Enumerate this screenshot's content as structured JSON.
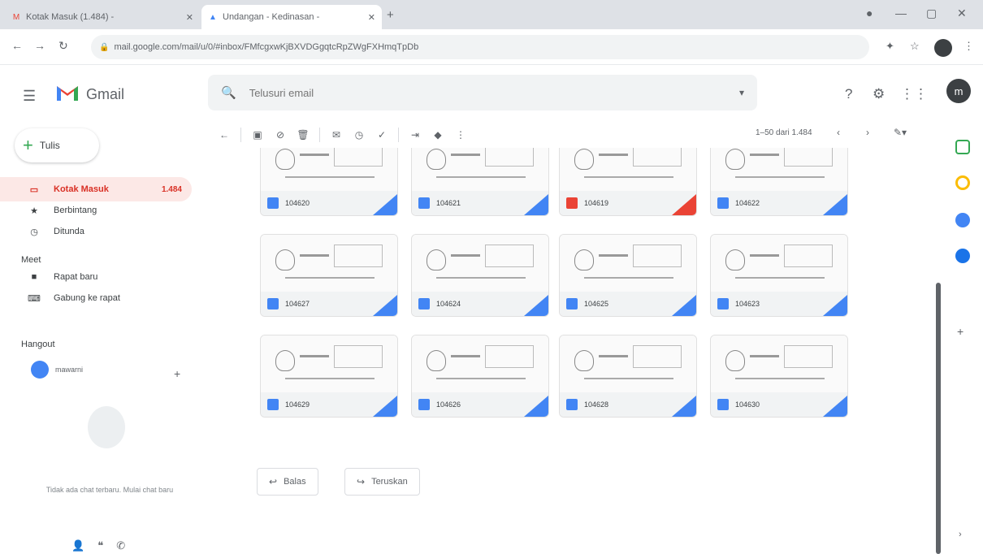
{
  "browser": {
    "tabs": [
      {
        "title": "Kotak Masuk (1.484) - ",
        "active": false
      },
      {
        "title": "Undangan - Kedinasan - ",
        "active": true
      }
    ],
    "url": "mail.google.com/mail/u/0/#inbox/FMfcgxwKjBXVDGgqtcRpZWgFXHmqTpDb"
  },
  "gmail": {
    "app_name": "Gmail",
    "search_placeholder": "Telusuri email",
    "avatar_initial": "m"
  },
  "sidebar": {
    "compose_label": "Tulis",
    "items": [
      {
        "label": "Kotak Masuk",
        "count": "1.484",
        "icon": "inbox-icon",
        "active": true
      },
      {
        "label": "Berbintang",
        "count": "",
        "icon": "star-icon",
        "active": false
      },
      {
        "label": "Ditunda",
        "count": "",
        "icon": "clock-icon",
        "active": false
      }
    ],
    "meet_heading": "Meet",
    "meet_items": [
      {
        "label": "Rapat baru",
        "icon": "video-icon"
      },
      {
        "label": "Gabung ke rapat",
        "icon": "keyboard-icon"
      }
    ],
    "hangouts_heading": "Hangout",
    "hangouts_user_name": "mawarni",
    "hangouts_user_status": "",
    "hangouts_message": "Tidak ada chat terbaru. Mulai chat baru",
    "hangouts_link": "",
    "bottom_icons": [
      "person-icon",
      "hangouts-icon",
      "phone-icon"
    ]
  },
  "toolbar": {
    "page_info": "1–50 dari 1.484",
    "icons": [
      "back-arrow-icon",
      "archive-icon",
      "report-spam-icon",
      "delete-icon",
      "mark-unread-icon",
      "snooze-icon",
      "add-task-icon",
      "move-to-icon",
      "label-icon",
      "more-icon"
    ]
  },
  "attachments": [
    {
      "name": "104620",
      "type": "doc",
      "row": 0,
      "col": 0
    },
    {
      "name": "104621",
      "type": "doc",
      "row": 0,
      "col": 1
    },
    {
      "name": "104619",
      "type": "pdf",
      "row": 0,
      "col": 2
    },
    {
      "name": "104622",
      "type": "doc",
      "row": 0,
      "col": 3
    },
    {
      "name": "104627",
      "type": "doc",
      "row": 1,
      "col": 0
    },
    {
      "name": "104624",
      "type": "doc",
      "row": 1,
      "col": 1
    },
    {
      "name": "104625",
      "type": "doc",
      "row": 1,
      "col": 2
    },
    {
      "name": "104623",
      "type": "doc",
      "row": 1,
      "col": 3
    },
    {
      "name": "104629",
      "type": "doc",
      "row": 2,
      "col": 0
    },
    {
      "name": "104626",
      "type": "doc",
      "row": 2,
      "col": 1
    },
    {
      "name": "104628",
      "type": "doc",
      "row": 2,
      "col": 2
    },
    {
      "name": "104630",
      "type": "doc",
      "row": 2,
      "col": 3
    }
  ],
  "actions": {
    "reply_label": "Balas",
    "forward_label": "Teruskan"
  },
  "side_panel": {
    "icons": [
      "calendar-icon",
      "keep-icon",
      "tasks-icon",
      "contacts-icon"
    ],
    "colors": [
      "#34a853",
      "#fbbc04",
      "#4285f4",
      "#1a73e8"
    ]
  },
  "colors": {
    "gmail_red": "#ea4335",
    "active_nav_bg": "#fce8e6",
    "doc_blue": "#4285f4"
  }
}
